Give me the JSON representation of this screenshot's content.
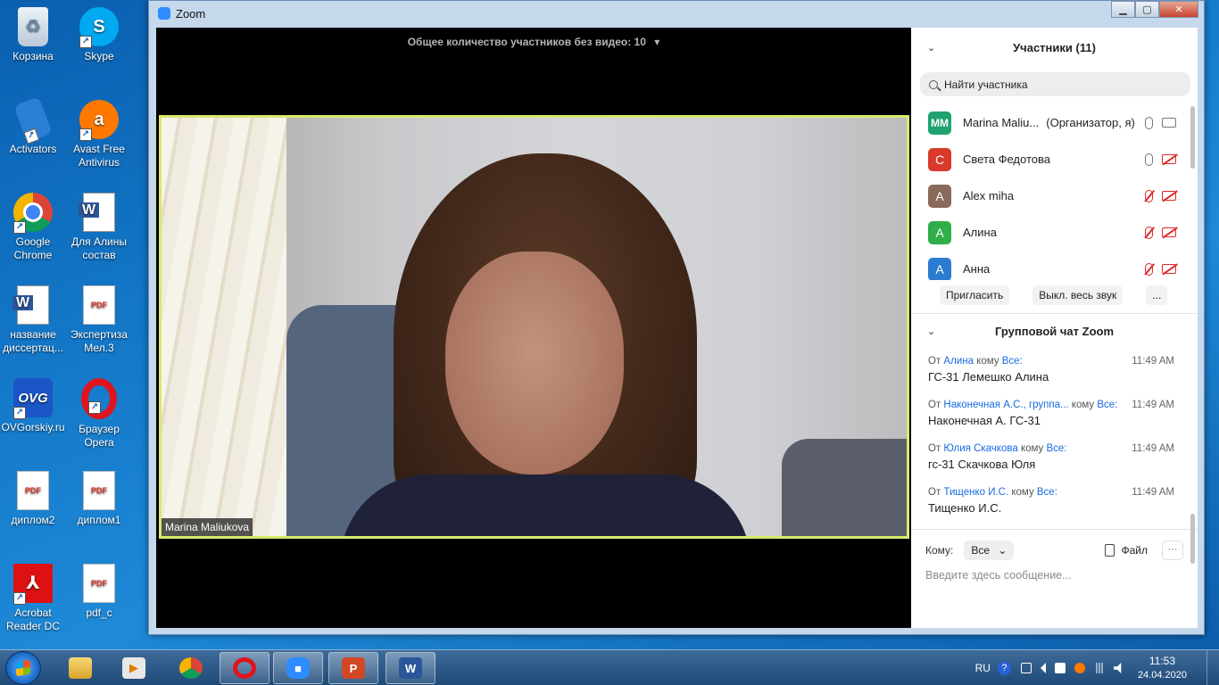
{
  "desktop": {
    "icons": [
      {
        "label": "Корзина"
      },
      {
        "label": "Skype"
      },
      {
        "label": "Activators"
      },
      {
        "label": "Avast Free Antivirus"
      },
      {
        "label": "Google Chrome"
      },
      {
        "label": "Для Алины состав"
      },
      {
        "label": "название диссертац..."
      },
      {
        "label": "Экспертиза Мел.3"
      },
      {
        "label": "OVGorskiy.ru"
      },
      {
        "label": "Браузер Opera"
      },
      {
        "label": "диплом2"
      },
      {
        "label": "диплом1"
      },
      {
        "label": "Acrobat Reader DC"
      },
      {
        "label": "pdf_c"
      }
    ],
    "glyphs": {
      "skype": "S",
      "avast": "a",
      "word": "W",
      "pdf": "PDF",
      "ovg": "OVG"
    }
  },
  "window": {
    "title": "Zoom",
    "controls": {
      "minimize": "▁",
      "maximize": "▢",
      "close": "✕"
    }
  },
  "video": {
    "no_video_count": "Общее количество участников без видео: 10",
    "dropdown_arrow": "▾",
    "speaker_name": "Marina Maliukova"
  },
  "participants": {
    "title": "Участники (11)",
    "chevron": "⌄",
    "search_placeholder": "Найти участника",
    "list": [
      {
        "initials": "MM",
        "name": "Marina Maliu...",
        "role": "(Организатор, я)",
        "color": "#1ea36f",
        "mic_muted": false,
        "cam_muted": false
      },
      {
        "initials": "С",
        "name": "Света Федотова",
        "role": "",
        "color": "#d93a2c",
        "mic_muted": false,
        "cam_muted": true
      },
      {
        "initials": "A",
        "name": "Alex miha",
        "role": "",
        "color": "#8a6a5a",
        "mic_muted": true,
        "cam_muted": true
      },
      {
        "initials": "А",
        "name": "Алина",
        "role": "",
        "color": "#2fae4a",
        "mic_muted": true,
        "cam_muted": true
      },
      {
        "initials": "А",
        "name": "Анна",
        "role": "",
        "color": "#2b7bd1",
        "mic_muted": true,
        "cam_muted": true
      }
    ],
    "invite_label": "Пригласить",
    "mute_all_label": "Выкл. весь звук",
    "more_label": "..."
  },
  "chat": {
    "title": "Групповой чат Zoom",
    "chevron": "⌄",
    "messages": [
      {
        "from_prefix": "От ",
        "sender": "Алина",
        "to_prefix": " кому ",
        "to": "Все:",
        "time": "11:49 AM",
        "text": "ГС-31 Лемешко Алина"
      },
      {
        "from_prefix": "От ",
        "sender": "Наконечная А.С., группа...",
        "to_prefix": " кому ",
        "to": "Все:",
        "time": "11:49 AM",
        "text": "Наконечная А. ГС-31"
      },
      {
        "from_prefix": "От ",
        "sender": "Юлия Скачкова",
        "to_prefix": " кому ",
        "to": "Все:",
        "time": "11:49 AM",
        "text": "гс-31 Скачкова Юля"
      },
      {
        "from_prefix": "От ",
        "sender": "Тищенко И.С.",
        "to_prefix": " кому ",
        "to": "Все:",
        "time": "11:49 AM",
        "text": "Тищенко И.С."
      }
    ],
    "to_label": "Кому:",
    "to_value": "Все",
    "to_arrow": "⌄",
    "file_label": "Файл",
    "more_label": "···",
    "input_placeholder": "Введите здесь сообщение..."
  },
  "taskbar": {
    "word_glyph": "W",
    "ppt_glyph": "P",
    "language": "RU",
    "help": "?",
    "time": "11:53",
    "date": "24.04.2020"
  }
}
